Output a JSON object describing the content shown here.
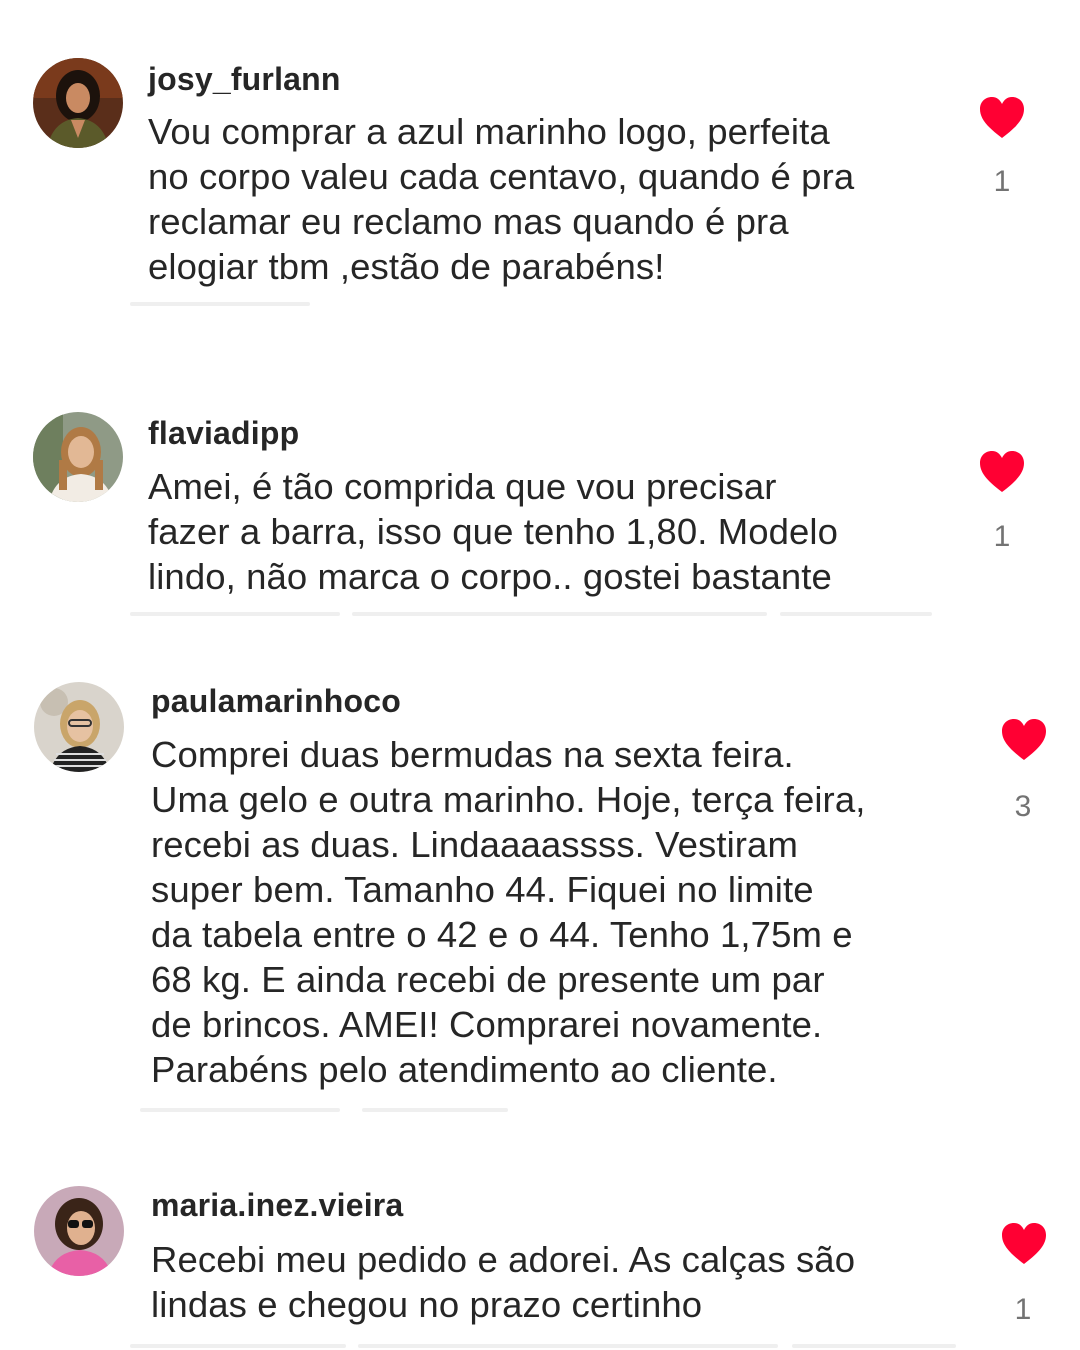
{
  "colors": {
    "heart": "#ff0033",
    "text": "#262626",
    "muted": "#737373"
  },
  "comments": [
    {
      "username": "josy_furlann",
      "avatar": "woman-dark-hair-avatar",
      "lines": [
        "Vou comprar a azul marinho logo, perfeita",
        "no corpo valeu cada centavo, quando é pra",
        "reclamar eu reclamo mas quando é pra",
        "elogiar tbm ,estão de parabéns!"
      ],
      "liked": true,
      "likes": "1"
    },
    {
      "username": "flaviadipp",
      "avatar": "woman-blonde-hair-avatar",
      "lines": [
        "Amei, é tão comprida que vou precisar",
        "fazer a barra, isso que tenho 1,80. Modelo",
        "lindo, não marca o corpo.. gostei bastante"
      ],
      "liked": true,
      "likes": "1"
    },
    {
      "username": "paulamarinhoco",
      "avatar": "woman-glasses-avatar",
      "lines": [
        "Comprei duas bermudas na sexta feira.",
        "Uma gelo e outra marinho. Hoje, terça feira,",
        "recebi as duas. Lindaaaassss. Vestiram",
        "super bem. Tamanho 44. Fiquei no limite",
        "da tabela entre o 42 e o 44. Tenho 1,75m e",
        "68 kg. E ainda recebi de presente um par",
        "de brincos. AMEI! Comprarei novamente.",
        "Parabéns pelo atendimento ao cliente."
      ],
      "liked": true,
      "likes": "3"
    },
    {
      "username": "maria.inez.vieira",
      "avatar": "woman-sunglasses-avatar",
      "lines": [
        "Recebi meu pedido e adorei. As calças são",
        "lindas e chegou no prazo certinho"
      ],
      "liked": true,
      "likes": "1"
    }
  ]
}
